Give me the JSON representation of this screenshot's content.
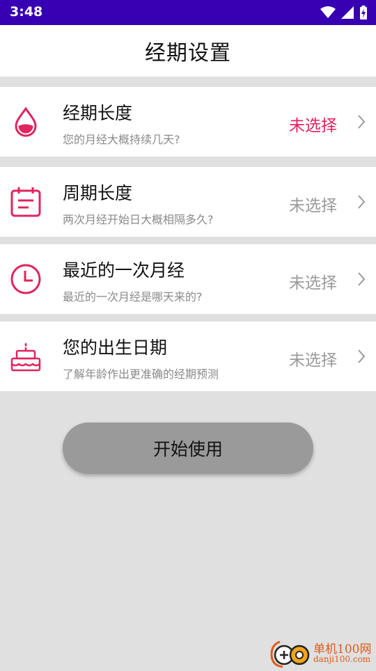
{
  "status_bar": {
    "time": "3:48"
  },
  "header": {
    "title": "经期设置"
  },
  "settings": [
    {
      "title": "经期长度",
      "subtitle": "您的月经大概持续几天?",
      "value": "未选择",
      "icon": "water-drop-icon",
      "value_color": "#e0245e"
    },
    {
      "title": "周期长度",
      "subtitle": "两次月经开始日大概相隔多久?",
      "value": "未选择",
      "icon": "calendar-icon",
      "value_color": "#9a9a9a"
    },
    {
      "title": "最近的一次月经",
      "subtitle": "最近的一次月经是哪天来的?",
      "value": "未选择",
      "icon": "clock-icon",
      "value_color": "#9a9a9a"
    },
    {
      "title": "您的出生日期",
      "subtitle": "了解年龄作出更准确的经期预测",
      "value": "未选择",
      "icon": "birthday-cake-icon",
      "value_color": "#9a9a9a"
    }
  ],
  "start_button": {
    "label": "开始使用"
  },
  "watermark": {
    "line1": "单机100网",
    "line2": "danji100.com"
  },
  "colors": {
    "accent": "#e0245e",
    "status_bar": "#3700b3",
    "background": "#e0e0e0",
    "button": "#9a9a9a"
  }
}
